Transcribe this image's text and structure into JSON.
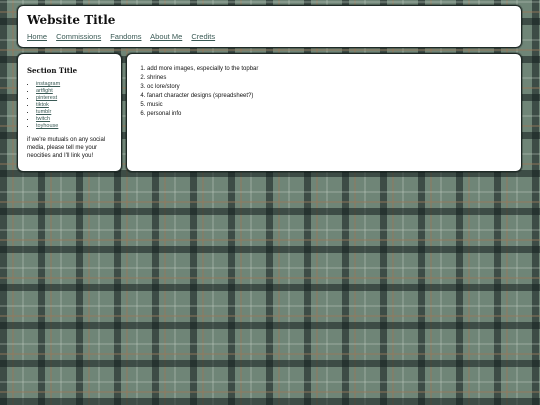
{
  "header": {
    "title": "Website Title",
    "nav": [
      {
        "label": "Home"
      },
      {
        "label": "Commissions"
      },
      {
        "label": "Fandoms"
      },
      {
        "label": "About Me"
      },
      {
        "label": "Credits"
      }
    ]
  },
  "sidebar": {
    "heading": "Section Title",
    "links": [
      "instagram",
      "artfight",
      "pinterest",
      "tiktok",
      "tumblr",
      "twitch",
      "toyhouse"
    ],
    "note": "if we're mutuals on any social media, please tell me your neocities and I'll link you!"
  },
  "main": {
    "todo": [
      "add more images, especially to the topbar",
      "shrines",
      "oc lore/story",
      "fanart character designs (spreadsheet?)",
      "music",
      "personal info"
    ]
  }
}
